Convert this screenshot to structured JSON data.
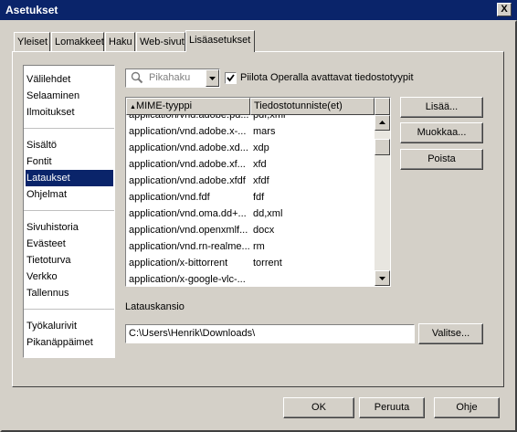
{
  "window": {
    "title": "Asetukset",
    "close_label": "X"
  },
  "tabs": [
    {
      "label": "Yleiset"
    },
    {
      "label": "Lomakkeet"
    },
    {
      "label": "Haku"
    },
    {
      "label": "Web-sivut"
    },
    {
      "label": "Lisäasetukset",
      "active": true
    }
  ],
  "nav": {
    "groups": [
      [
        "Välilehdet",
        "Selaaminen",
        "Ilmoitukset"
      ],
      [
        "Sisältö",
        "Fontit",
        "Lataukset",
        "Ohjelmat"
      ],
      [
        "Sivuhistoria",
        "Evästeet",
        "Tietoturva",
        "Verkko",
        "Tallennus"
      ],
      [
        "Työkalurivit",
        "Pikanäppäimet"
      ]
    ],
    "selected": "Lataukset"
  },
  "search": {
    "placeholder": "Pikahaku",
    "icon": "magnifier-icon"
  },
  "hide_opened_checkbox": {
    "label": "Piilota Operalla avattavat tiedostotyypit",
    "checked": true
  },
  "mime_table": {
    "columns": [
      "MIME-tyyppi",
      "Tiedostotunniste(et)"
    ],
    "sort_indicator": "▲",
    "rows": [
      [
        "application/vnd.adobe.pd...",
        "pdf,xml"
      ],
      [
        "application/vnd.adobe.x-...",
        "mars"
      ],
      [
        "application/vnd.adobe.xd...",
        "xdp"
      ],
      [
        "application/vnd.adobe.xf...",
        "xfd"
      ],
      [
        "application/vnd.adobe.xfdf",
        "xfdf"
      ],
      [
        "application/vnd.fdf",
        "fdf"
      ],
      [
        "application/vnd.oma.dd+...",
        "dd,xml"
      ],
      [
        "application/vnd.openxmlf...",
        "docx"
      ],
      [
        "application/vnd.rn-realme...",
        "rm"
      ],
      [
        "application/x-bittorrent",
        "torrent"
      ],
      [
        "application/x-google-vlc-...",
        ""
      ]
    ]
  },
  "side_buttons": {
    "add": "Lisää...",
    "edit": "Muokkaa...",
    "remove": "Poista"
  },
  "download_folder": {
    "label": "Latauskansio",
    "path": "C:\\Users\\Henrik\\Downloads\\",
    "choose": "Valitse..."
  },
  "footer": {
    "ok": "OK",
    "cancel": "Peruuta",
    "help": "Ohje"
  },
  "colors": {
    "titlebar": "#0a246a",
    "face": "#d4d0c8",
    "selection": "#0a246a"
  }
}
